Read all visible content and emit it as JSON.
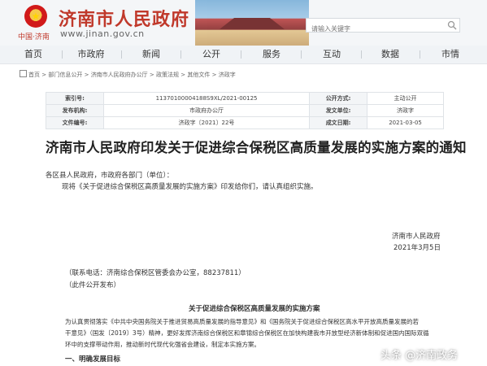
{
  "header": {
    "site_title": "济南市人民政府",
    "site_url": "www.jinan.gov.cn",
    "brand_mini": "中国·济南",
    "search_placeholder": "请输入关键字"
  },
  "nav": {
    "items": [
      "首页",
      "市政府",
      "新闻",
      "公开",
      "服务",
      "互动",
      "数据",
      "市情"
    ]
  },
  "breadcrumb": {
    "items": [
      "首页",
      "部门信息公开",
      "济南市人民政府办公厅",
      "政策法规",
      "其他文件",
      "济政字"
    ],
    "separator": ">"
  },
  "meta": {
    "rows": [
      {
        "k1": "索引号:",
        "v1": "11370100004188S9XL/2021-00125",
        "k2": "公开方式:",
        "v2": "主动公开"
      },
      {
        "k1": "发布机构:",
        "v1": "市政府办公厅",
        "k2": "发文单位:",
        "v2": "济政字"
      },
      {
        "k1": "文件编号:",
        "v1": "济政字〔2021〕22号",
        "k2": "成文日期:",
        "v2": "2021-03-05"
      }
    ]
  },
  "doc": {
    "title": "济南市人民政府印发关于促进综合保税区高质量发展的实施方案的通知",
    "addressee": "各区县人民政府，市政府各部门（单位）：",
    "body": "现将《关于促进综合保税区高质量发展的实施方案》印发给你们，请认真组织实施。",
    "issuer": "济南市人民政府",
    "date": "2021年3月5日",
    "contact": "（联系电话：济南综合保税区管委会办公室，88237811）",
    "public_note": "（此件公开发布）",
    "section_title": "关于促进综合保税区高质量发展的实施方案",
    "para1_line1": "为认真贯彻落实《中共中央国务院关于推进贸易高质量发展的指导意见》和《国务院关于促进综合保税区高水平开放高质量发展的若",
    "para1_line2": "干意见》（国发〔2019〕3号）精神，更好发挥济南综合保税区和章锦综合保税区在加快构建我市开放型经济新体制和促进国内国际双循",
    "para1_line3": "环中的支撑带动作用，推动新时代现代化强省会建设，制定本实施方案。",
    "heading1": "一、明确发展目标"
  },
  "watermark": "头条 @济南政务"
}
